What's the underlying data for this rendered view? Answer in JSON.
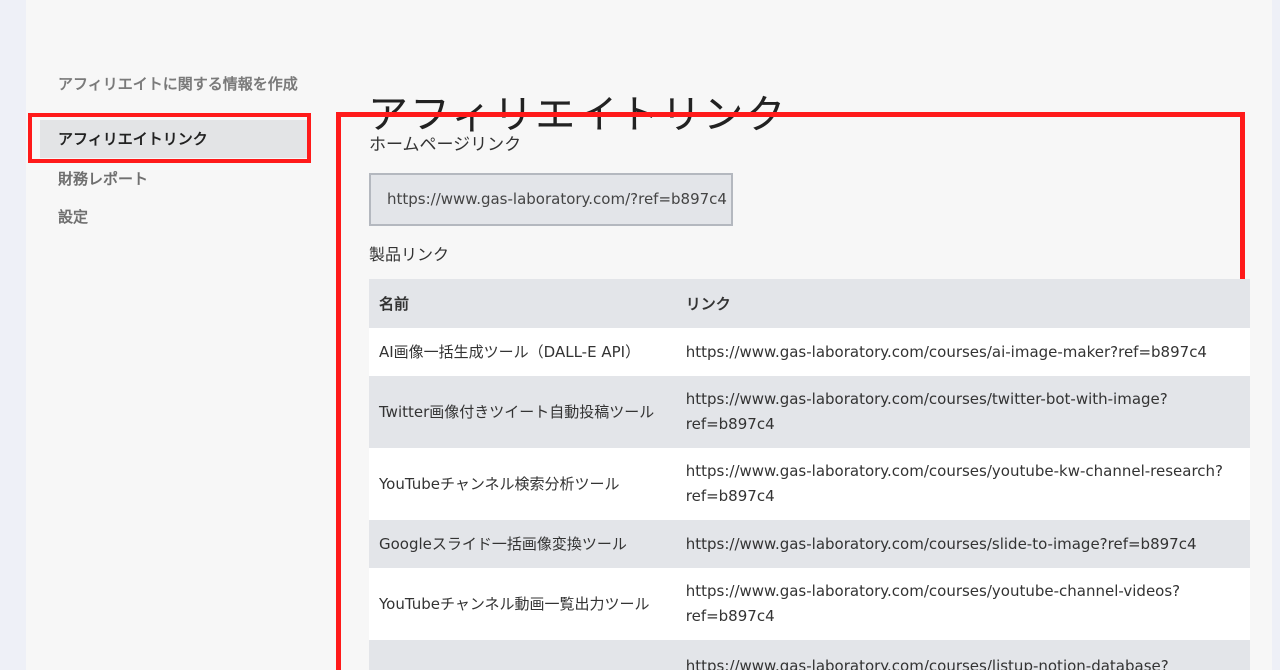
{
  "sidebar": {
    "group_label": "アフィリエイトに関する情報を作成",
    "items": [
      {
        "label": "アフィリエイトリンク",
        "active": true
      },
      {
        "label": "財務レポート",
        "active": false
      },
      {
        "label": "設定",
        "active": false
      }
    ]
  },
  "main": {
    "title": "アフィリエイトリンク",
    "homepage_section_label": "ホームページリンク",
    "homepage_link": "https://www.gas-laboratory.com/?ref=b897c4",
    "product_section_label": "製品リンク",
    "table": {
      "columns": [
        "名前",
        "リンク"
      ],
      "rows": [
        {
          "name": "AI画像一括生成ツール（DALL-E API）",
          "link": "https://www.gas-laboratory.com/courses/ai-image-maker?ref=b897c4"
        },
        {
          "name": "Twitter画像付きツイート自動投稿ツール",
          "link": "https://www.gas-laboratory.com/courses/twitter-bot-with-image?ref=b897c4"
        },
        {
          "name": "YouTubeチャンネル検索分析ツール",
          "link": "https://www.gas-laboratory.com/courses/youtube-kw-channel-research?ref=b897c4"
        },
        {
          "name": "Googleスライド一括画像変換ツール",
          "link": "https://www.gas-laboratory.com/courses/slide-to-image?ref=b897c4"
        },
        {
          "name": "YouTubeチャンネル動画一覧出力ツール",
          "link": "https://www.gas-laboratory.com/courses/youtube-channel-videos?ref=b897c4"
        },
        {
          "name": "",
          "link": "https://www.gas-laboratory.com/courses/listup-notion-database?"
        }
      ]
    }
  },
  "colors": {
    "highlight_frame": "#ff1a1a",
    "active_nav_bg": "#e3e4e6",
    "table_header_bg": "#e3e5e9"
  }
}
